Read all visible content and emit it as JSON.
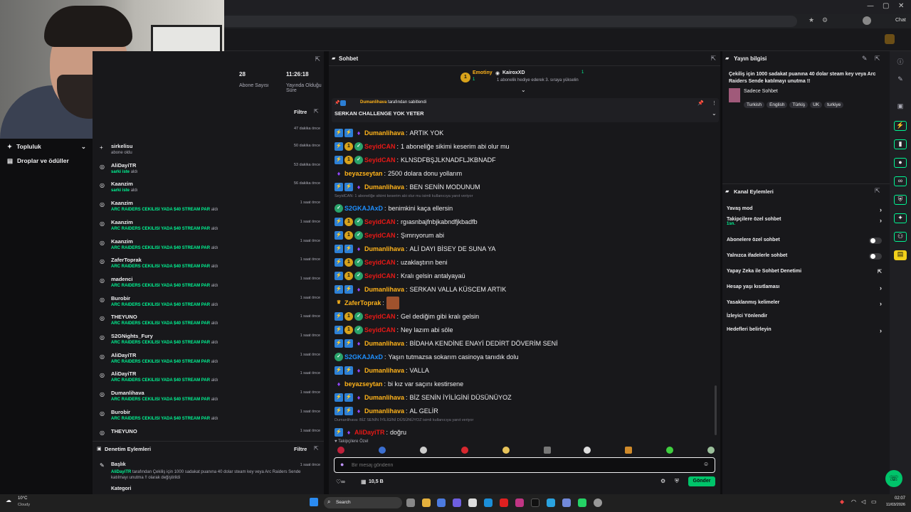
{
  "browser": {
    "chat_button": "Chat",
    "close_icon": "✕",
    "min_icon": "—",
    "max_icon": "▢"
  },
  "left_nav": {
    "items": [
      {
        "label": "Topluluk"
      },
      {
        "label": "Droplar ve ödüller"
      }
    ]
  },
  "stats": {
    "subs": "28",
    "subs_label": "Abone Sayısı",
    "duration": "11:26:18",
    "duration_label": "Yayında Olduğu Süre"
  },
  "activity": {
    "filter_label": "Filtre",
    "first_time": "47 dakika önce",
    "rows": [
      {
        "name": "sirkelisu",
        "sub": "abone oldu",
        "time": "50 dakika önce",
        "icon": "+"
      },
      {
        "name": "AliDayiTR",
        "sub_green": "sarki iste",
        "sub": " aldı",
        "time": "53 dakika önce",
        "icon": "◎"
      },
      {
        "name": "Kaanzim",
        "sub_green": "sarki iste",
        "sub": " aldı",
        "time": "56 dakika önce",
        "icon": "◎"
      },
      {
        "name": "Kaanzim",
        "sub_green": "ARC RAIDERS CEKILISI YADA $40 STREAM PAR",
        "sub": " aldı",
        "time": "1 saat önce",
        "icon": "◎"
      },
      {
        "name": "Kaanzim",
        "sub_green": "ARC RAIDERS CEKILISI YADA $40 STREAM PAR",
        "sub": " aldı",
        "time": "1 saat önce",
        "icon": "◎"
      },
      {
        "name": "Kaanzim",
        "sub_green": "ARC RAIDERS CEKILISI YADA $40 STREAM PAR",
        "sub": " aldı",
        "time": "1 saat önce",
        "icon": "◎"
      },
      {
        "name": "ZaferToprak",
        "sub_green": "ARC RAIDERS CEKILISI YADA $40 STREAM PAR",
        "sub": " aldı",
        "time": "1 saat önce",
        "icon": "◎"
      },
      {
        "name": "madenci",
        "sub_green": "ARC RAIDERS CEKILISI YADA $40 STREAM PAR",
        "sub": " aldı",
        "time": "1 saat önce",
        "icon": "◎"
      },
      {
        "name": "Burobir",
        "sub_green": "ARC RAIDERS CEKILISI YADA $40 STREAM PAR",
        "sub": " aldı",
        "time": "1 saat önce",
        "icon": "◎"
      },
      {
        "name": "THEYUNO",
        "sub_green": "ARC RAIDERS CEKILISI YADA $40 STREAM PAR",
        "sub": " aldı",
        "time": "1 saat önce",
        "icon": "◎"
      },
      {
        "name": "S2GNights_Fury",
        "sub_green": "ARC RAIDERS CEKILISI YADA $40 STREAM PAR",
        "sub": " aldı",
        "time": "1 saat önce",
        "icon": "◎"
      },
      {
        "name": "AliDayiTR",
        "sub_green": "ARC RAIDERS CEKILISI YADA $40 STREAM PAR",
        "sub": " aldı",
        "time": "1 saat önce",
        "icon": "◎"
      },
      {
        "name": "AliDayiTR",
        "sub_green": "ARC RAIDERS CEKILISI YADA $40 STREAM PAR",
        "sub": " aldı",
        "time": "1 saat önce",
        "icon": "◎"
      },
      {
        "name": "Dumanlihava",
        "sub_green": "ARC RAIDERS CEKILISI YADA $40 STREAM PAR",
        "sub": " aldı",
        "time": "1 saat önce",
        "icon": "◎"
      },
      {
        "name": "Burobir",
        "sub_green": "ARC RAIDERS CEKILISI YADA $40 STREAM PAR",
        "sub": " aldı",
        "time": "1 saat önce",
        "icon": "◎"
      },
      {
        "name": "THEYUNO",
        "sub_green": "",
        "sub": "",
        "time": "1 saat önce",
        "icon": "◎"
      }
    ]
  },
  "moderation": {
    "title": "Denetim Eylemleri",
    "filter_label": "Filtre",
    "row_title": "Başlık",
    "row_user": "AliDayiTR",
    "row_text": " tarafından Çekiliş için 1000 sadakat puanına 40 dolar steam key veya Arc Raiders Sende katılmayı unutma !! olarak değiştirildi",
    "row_time": "1 saat önce",
    "next_label": "Kategori"
  },
  "chat": {
    "title": "Sohbet",
    "leader": {
      "rank": "1",
      "name": "Emotiny",
      "count": "1",
      "top_name": "KairoxXD",
      "top_count": "1",
      "note": "1 abonelik hediye ederek 3. sıraya yükselin"
    },
    "pinned": {
      "by": "Dumanlihava",
      "by_suffix": " tarafından sabitlendi",
      "text": "SERKAN CHALLENGE YOK YETER"
    },
    "messages": [
      {
        "badges": [
          "sq",
          "sq",
          "pu"
        ],
        "user": "Dumanlihava",
        "color": "#ffb31a",
        "text": "ARTIK YOK"
      },
      {
        "badges": [
          "sq",
          "gold",
          "gr"
        ],
        "user": "SeyidCAN",
        "color": "#e91916",
        "text": "1 aboneliğe sikimi keserim abi olur mu"
      },
      {
        "badges": [
          "sq",
          "gold",
          "gr"
        ],
        "user": "SeyidCAN",
        "color": "#e91916",
        "text": "KLNSDFBŞJLKNADFLJKBNADF"
      },
      {
        "badges": [
          "pu"
        ],
        "user": "beyazseytan",
        "color": "#ffb31a",
        "text": "2500 dolara donu yollarım"
      },
      {
        "badges": [
          "sq",
          "sq",
          "pu"
        ],
        "user": "Dumanlihava",
        "color": "#ffb31a",
        "text": "BEN SENİN MODUNUM"
      },
      {
        "reply": "SeyidCAN: 1 aboneliğe sikimi keserim abi olur mu isimli kullanıcıya yanıt veriyor"
      },
      {
        "badges": [
          "gr"
        ],
        "user": "S2GKAJAxD",
        "color": "#1e90ff",
        "text": "benimkini kaça ellersin"
      },
      {
        "badges": [
          "sq",
          "gold",
          "gr"
        ],
        "user": "SeyidCAN",
        "color": "#e91916",
        "text": "rgıasnbajfnbjkabndfjkbadfb"
      },
      {
        "badges": [
          "sq",
          "gold",
          "gr"
        ],
        "user": "SeyidCAN",
        "color": "#e91916",
        "text": "Şımrıyorum abi"
      },
      {
        "badges": [
          "sq",
          "sq",
          "pu"
        ],
        "user": "Dumanlihava",
        "color": "#ffb31a",
        "text": "ALİ DAYI BİSEY DE SUNA YA"
      },
      {
        "badges": [
          "sq",
          "gold",
          "gr"
        ],
        "user": "SeyidCAN",
        "color": "#e91916",
        "text": "uzaklaştırın beni"
      },
      {
        "badges": [
          "sq",
          "gold",
          "gr"
        ],
        "user": "SeyidCAN",
        "color": "#e91916",
        "text": "Kralı gelsin antalyayaü"
      },
      {
        "badges": [
          "sq",
          "sq",
          "pu"
        ],
        "user": "Dumanlihava",
        "color": "#ffb31a",
        "text": "SERKAN VALLA KÜSCEM ARTIK"
      },
      {
        "badges": [
          "crown"
        ],
        "user": "ZaferToprak",
        "color": "#ffb31a",
        "text": "",
        "emote": true
      },
      {
        "badges": [
          "sq",
          "gold",
          "gr"
        ],
        "user": "SeyidCAN",
        "color": "#e91916",
        "text": "Gel dediğim gibi kralı gelsin"
      },
      {
        "badges": [
          "sq",
          "gold",
          "gr"
        ],
        "user": "SeyidCAN",
        "color": "#e91916",
        "text": "Ney lazım abi söle"
      },
      {
        "badges": [
          "sq",
          "sq",
          "pu"
        ],
        "user": "Dumanlihava",
        "color": "#ffb31a",
        "text": "BİDAHA KENDİNE ENAYİ DEDİRT DÖVERİM SENİ"
      },
      {
        "badges": [
          "gr"
        ],
        "user": "S2GKAJAxD",
        "color": "#1e90ff",
        "text": "Yaşın tutmazsa sokarım casinoya tanıdık dolu"
      },
      {
        "badges": [
          "sq",
          "sq",
          "pu"
        ],
        "user": "Dumanlihava",
        "color": "#ffb31a",
        "text": "VALLA"
      },
      {
        "badges": [
          "pu"
        ],
        "user": "beyazseytan",
        "color": "#ffb31a",
        "text": "bi kız var saçını kestirsene"
      },
      {
        "badges": [
          "sq",
          "sq",
          "pu"
        ],
        "user": "Dumanlihava",
        "color": "#ffb31a",
        "text": "BİZ SENİN İYİLİGİNİ DÜSÜNÜYOZ"
      },
      {
        "badges": [
          "sq",
          "sq",
          "pu"
        ],
        "user": "Dumanlihava",
        "color": "#ffb31a",
        "text": "AL GELİR"
      },
      {
        "reply": "Dumanlihava: BİZ SENİN İYİLİGİNİ DÜSÜNÜYOZ isimli kullanıcıya yanıt veriyor"
      },
      {
        "badges": [
          "sq",
          "pu"
        ],
        "user": "AliDayiTR",
        "color": "#e91916",
        "text": "doğru"
      }
    ],
    "followers_only": "Takipçilere Özel",
    "input_placeholder": "Bir mesaj gönderin",
    "points": "10,5 B",
    "send_label": "Gönder"
  },
  "stream_info": {
    "title": "Yayın bilgisi",
    "stream_title": "Çekiliş için 1000 sadakat puanına 40 dolar steam key veya Arc Raiders Sende katılmayı unutma !!",
    "category": "Sadece Sohbet",
    "tags": [
      "Turkish",
      "English",
      "Türkiş",
      "UK",
      "turkiye"
    ]
  },
  "channel_actions": {
    "title": "Kanal Eylemleri",
    "items": [
      {
        "label": "Yavaş mod",
        "kind": "chev"
      },
      {
        "label": "Takipçilere özel sohbet",
        "sub": "1sn.",
        "kind": "chev"
      },
      {
        "label": "Abonelere özel sohbet",
        "kind": "toggle"
      },
      {
        "label": "Yalnızca ifadelerle sohbet",
        "kind": "toggle"
      },
      {
        "label": "Yapay Zeka ile Sohbet Denetimi",
        "kind": "ext"
      },
      {
        "label": "Hesap yaşı kısıtlaması",
        "kind": "chev"
      },
      {
        "label": "Yasaklanmış kelimeler",
        "kind": "chev"
      },
      {
        "label": "İzleyici Yönlendir",
        "kind": "none"
      },
      {
        "label": "Hedefleri belirleyin",
        "kind": "chev"
      }
    ]
  },
  "taskbar": {
    "weather_temp": "10°C",
    "weather_desc": "Cloudy",
    "search": "Search",
    "time": "02:07",
    "date": "11/03/2026"
  }
}
